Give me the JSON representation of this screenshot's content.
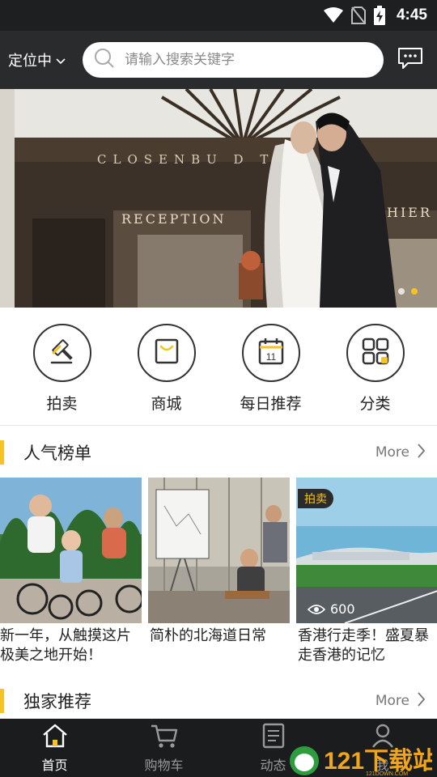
{
  "status_bar": {
    "time": "4:45",
    "icons": [
      "wifi-icon",
      "no-sim-icon",
      "battery-charging-icon"
    ]
  },
  "header": {
    "location_label": "定位中",
    "search_placeholder": "请输入搜索关键字",
    "message_icon": "chat-icon"
  },
  "banner": {
    "sign_top": "CLOSENBU  D T",
    "sign_reception": "RECEPTION",
    "sign_right": "HIER",
    "slides": 2,
    "active_slide": 1
  },
  "categories": [
    {
      "label": "拍卖",
      "icon": "auction-hammer-icon"
    },
    {
      "label": "商城",
      "icon": "shopping-bag-icon"
    },
    {
      "label": "每日推荐",
      "icon": "calendar-icon",
      "icon_text": "11"
    },
    {
      "label": "分类",
      "icon": "category-grid-icon"
    }
  ],
  "sections": {
    "popular": {
      "title": "人气榜单",
      "more": "More"
    },
    "exclusive": {
      "title": "独家推荐",
      "more": "More"
    }
  },
  "popular_items": [
    {
      "title": "新一年，从触摸这片极美之地开始！"
    },
    {
      "title": "简朴的北海道日常"
    },
    {
      "title": "香港行走季！盛夏暴走香港的记忆",
      "tag": "拍卖",
      "views": "600"
    }
  ],
  "bottom_nav": [
    {
      "label": "首页",
      "icon": "home-icon",
      "active": true
    },
    {
      "label": "购物车",
      "icon": "cart-icon",
      "active": false
    },
    {
      "label": "动态",
      "icon": "news-icon",
      "active": false
    },
    {
      "label": "我",
      "icon": "user-icon",
      "active": false
    }
  ],
  "watermark": {
    "text": "121下载站",
    "sub": "121DOWN.COM"
  },
  "colors": {
    "accent": "#f6c224",
    "header_bg": "#2a2b2d",
    "nav_bg": "#1b1c1e"
  }
}
